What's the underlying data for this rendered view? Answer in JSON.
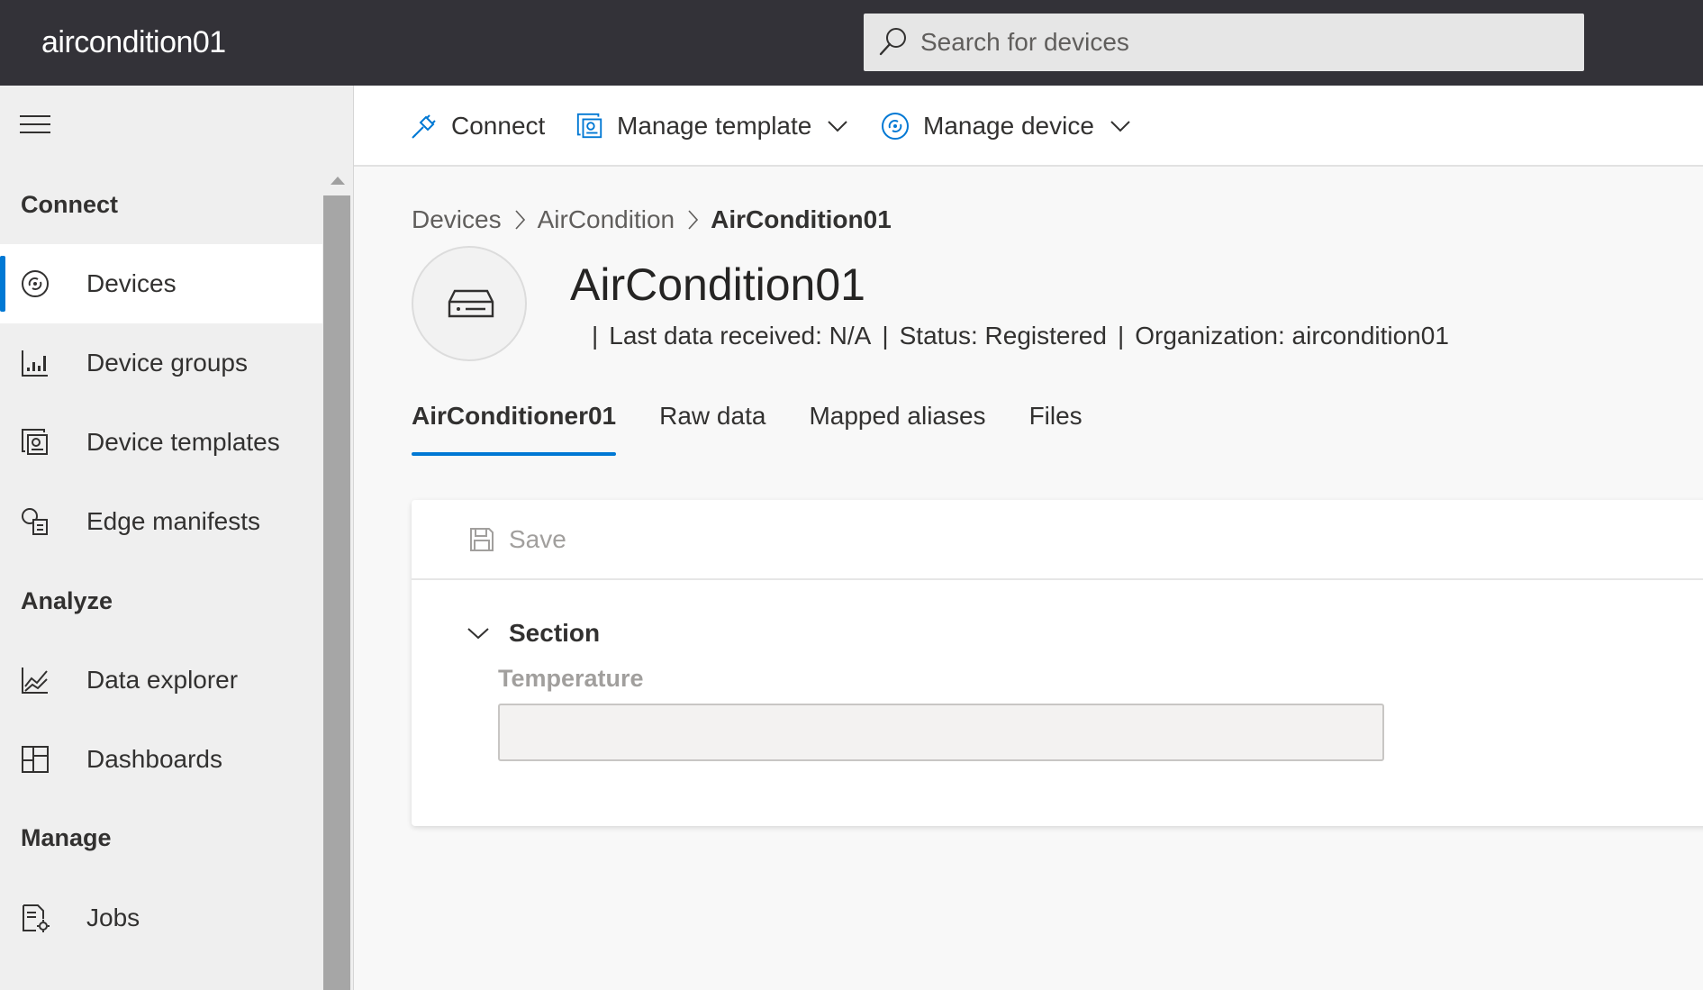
{
  "app": {
    "title": "aircondition01"
  },
  "search": {
    "placeholder": "Search for devices"
  },
  "sidebar": {
    "sections": [
      {
        "label": "Connect"
      },
      {
        "label": "Analyze"
      },
      {
        "label": "Manage"
      }
    ],
    "items": [
      {
        "label": "Devices",
        "icon": "devices-icon",
        "active": true
      },
      {
        "label": "Device groups",
        "icon": "device-groups-icon"
      },
      {
        "label": "Device templates",
        "icon": "device-templates-icon"
      },
      {
        "label": "Edge manifests",
        "icon": "edge-manifests-icon"
      },
      {
        "label": "Data explorer",
        "icon": "data-explorer-icon"
      },
      {
        "label": "Dashboards",
        "icon": "dashboards-icon"
      },
      {
        "label": "Jobs",
        "icon": "jobs-icon"
      }
    ]
  },
  "toolbar": {
    "connect_label": "Connect",
    "manage_template_label": "Manage template",
    "manage_device_label": "Manage device"
  },
  "breadcrumb": [
    "Devices",
    "AirCondition",
    "AirCondition01"
  ],
  "device": {
    "name": "AirCondition01",
    "last_data": "Last data received: N/A",
    "status": "Status: Registered",
    "organization": "Organization: aircondition01"
  },
  "tabs": [
    {
      "label": "AirConditioner01",
      "active": true
    },
    {
      "label": "Raw data"
    },
    {
      "label": "Mapped aliases"
    },
    {
      "label": "Files"
    }
  ],
  "form": {
    "save_label": "Save",
    "section_label": "Section",
    "temperature_label": "Temperature",
    "temperature_value": ""
  },
  "colors": {
    "topbar": "#333238",
    "accent": "#0078d4",
    "sidebar_bg": "#efefef"
  }
}
